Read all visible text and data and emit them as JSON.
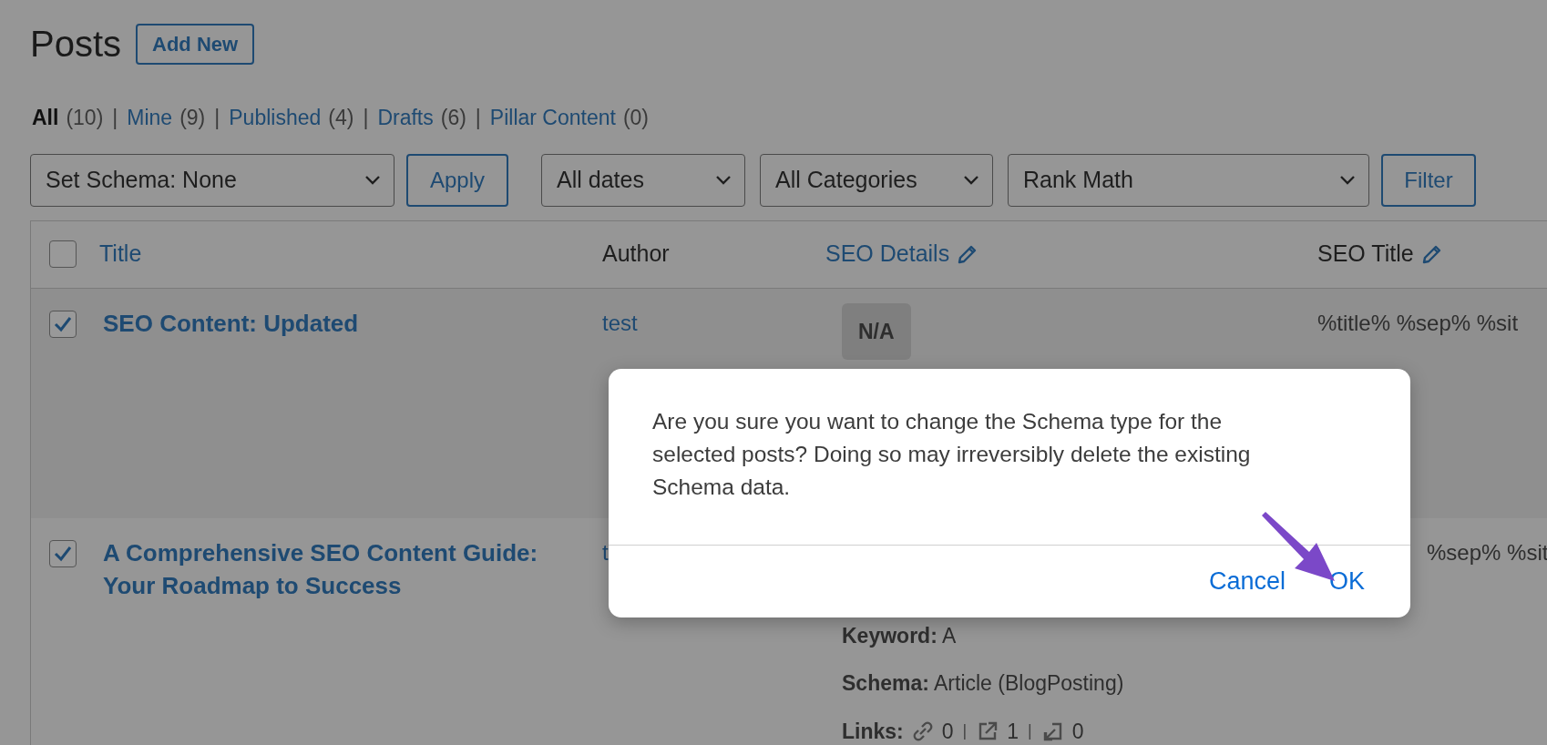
{
  "page": {
    "title": "Posts",
    "add_new": "Add New"
  },
  "view_separator": "|",
  "views": [
    {
      "label": "All",
      "count": "(10)",
      "selected": true
    },
    {
      "label": "Mine",
      "count": "(9)",
      "selected": false
    },
    {
      "label": "Published",
      "count": "(4)",
      "selected": false
    },
    {
      "label": "Drafts",
      "count": "(6)",
      "selected": false
    },
    {
      "label": "Pillar Content",
      "count": "(0)",
      "selected": false
    }
  ],
  "toolbar": {
    "bulk_action": "Set Schema: None",
    "apply": "Apply",
    "dropdowns": [
      "All dates",
      "All Categories",
      "Rank Math"
    ],
    "filter": "Filter"
  },
  "table": {
    "select_all": {
      "checked": false
    },
    "columns": [
      {
        "label": "Title",
        "kind": "link",
        "editable": false
      },
      {
        "label": "Author",
        "kind": "text",
        "editable": false
      },
      {
        "label": "SEO Details",
        "kind": "link",
        "editable": true
      },
      {
        "label": "SEO Title",
        "kind": "text",
        "editable": true
      }
    ],
    "rows": [
      {
        "checked": true,
        "title": "SEO Content: Updated",
        "author": "test",
        "seo_details": {
          "badge": "N/A"
        },
        "seo_title": "%title% %sep% %sit"
      },
      {
        "checked": true,
        "title": "A Comprehensive SEO Content Guide: Your Roadmap to Success",
        "author": "t",
        "seo_details": {
          "keyword_label": "Keyword:",
          "keyword": "A",
          "schema_label": "Schema:",
          "schema": "Article (BlogPosting)",
          "links_label": "Links:",
          "links_separator": "|",
          "links": [
            {
              "kind": "internal",
              "count": "0"
            },
            {
              "kind": "external",
              "count": "1"
            },
            {
              "kind": "incoming",
              "count": "0"
            }
          ]
        },
        "seo_title": "%sep% %sit"
      }
    ]
  },
  "dialog": {
    "message": "Are you sure you want to change the Schema type for the selected posts? Doing so may irreversibly delete the existing Schema data.",
    "buttons": [
      {
        "label": "Cancel"
      },
      {
        "label": "OK"
      }
    ]
  }
}
